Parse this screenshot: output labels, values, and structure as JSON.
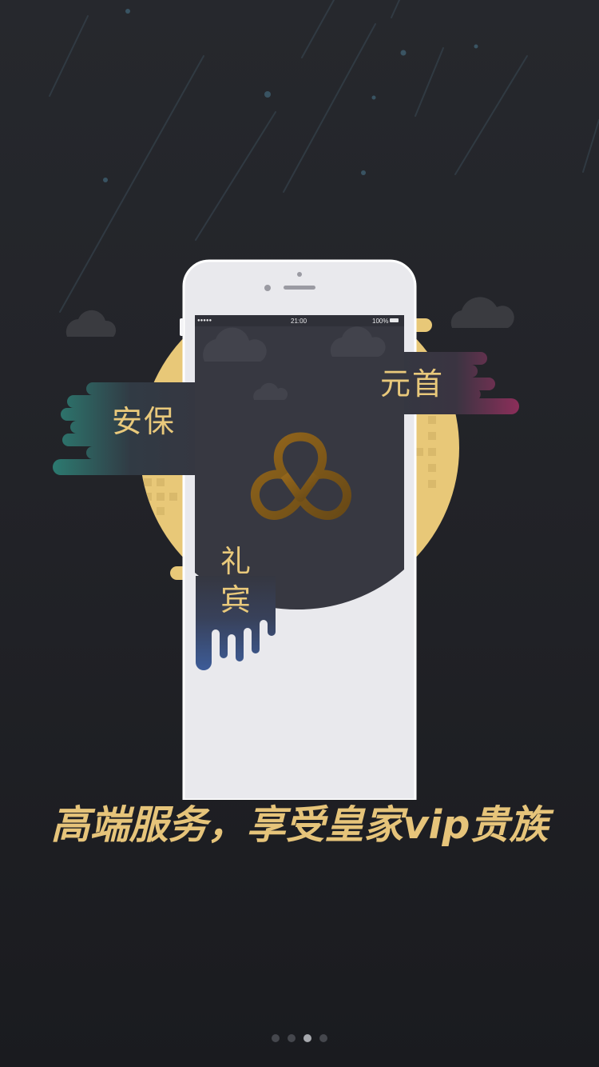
{
  "phone": {
    "status_bar": {
      "signal": "●●●●●",
      "time": "21:00",
      "battery": "100%"
    }
  },
  "services": {
    "security": "安保",
    "head": "元首",
    "etiquette_line1": "礼",
    "etiquette_line2": "宾"
  },
  "tagline": "高端服务，享受皇家vip贵族",
  "pager": {
    "count": 4,
    "active_index": 2
  },
  "colors": {
    "background": "#222328",
    "gold": "#e6c47a",
    "teal": "#2e7a70",
    "magenta": "#8a2f5a",
    "blue": "#3d5a94",
    "screen": "#373841"
  }
}
